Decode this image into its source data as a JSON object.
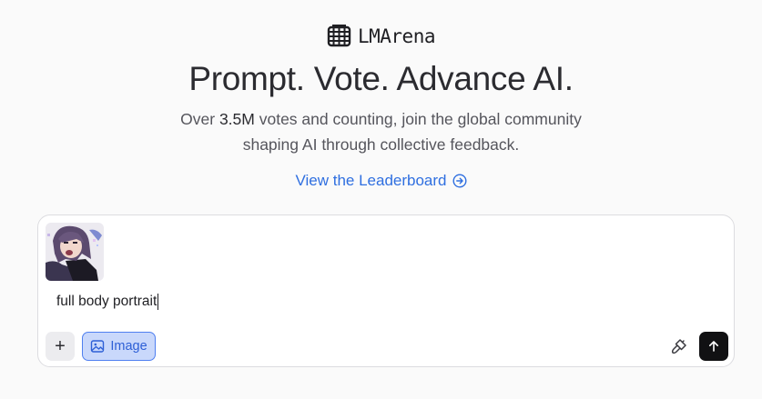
{
  "brand": {
    "name": "LMArena",
    "logo_icon": "arena-grid-icon"
  },
  "hero": {
    "headline": "Prompt. Vote. Advance AI.",
    "subtext_prefix": "Over ",
    "subtext_highlight": "3.5M",
    "subtext_line1_rest": " votes and counting, join the global community",
    "subtext_line2": "shaping AI through collective feedback."
  },
  "leaderboard_link": {
    "label": "View the Leaderboard",
    "icon": "arrow-right-circle-icon"
  },
  "composer": {
    "attachment": {
      "icon": "image-thumbnail"
    },
    "prompt_value": "full body portrait",
    "add_button": {
      "label": "+",
      "icon": "plus-icon"
    },
    "image_mode_button": {
      "label": "Image",
      "icon": "image-icon",
      "active": true
    },
    "tool_button": {
      "icon": "paint-brush-icon"
    },
    "send_button": {
      "icon": "arrow-up-icon"
    }
  },
  "colors": {
    "background": "#fafafa",
    "link": "#2f6fe0",
    "image_button_bg": "#c9d8fb",
    "image_button_border": "#4f7ff0",
    "send_button_bg": "#111113"
  }
}
